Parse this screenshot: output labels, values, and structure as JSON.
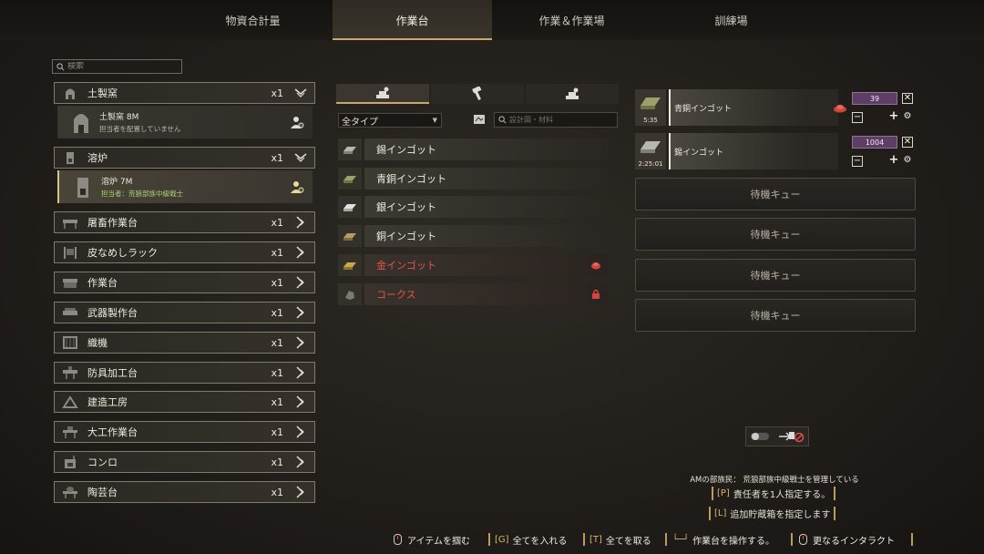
{
  "tabs": [
    {
      "label": "物資合計量"
    },
    {
      "label": "作業台"
    },
    {
      "label": "作業＆作業場"
    },
    {
      "label": "訓練場"
    }
  ],
  "active_tab": 1,
  "search": {
    "placeholder": "検索"
  },
  "stations": [
    {
      "name": "土製窯",
      "count": "x1",
      "icon": "kiln-icon",
      "expanded": true
    },
    {
      "name": "溶炉",
      "count": "x1",
      "icon": "furnace-icon",
      "expanded": true
    },
    {
      "name": "屠畜作業台",
      "count": "x1",
      "icon": "butcher-table-icon"
    },
    {
      "name": "皮なめしラック",
      "count": "x1",
      "icon": "tanning-rack-icon"
    },
    {
      "name": "作業台",
      "count": "x1",
      "icon": "workbench-icon"
    },
    {
      "name": "武器製作台",
      "count": "x1",
      "icon": "weapon-bench-icon"
    },
    {
      "name": "織機",
      "count": "x1",
      "icon": "loom-icon"
    },
    {
      "name": "防具加工台",
      "count": "x1",
      "icon": "armor-bench-icon"
    },
    {
      "name": "建造工房",
      "count": "x1",
      "icon": "construction-workshop-icon"
    },
    {
      "name": "大工作業台",
      "count": "x1",
      "icon": "carpentry-bench-icon"
    },
    {
      "name": "コンロ",
      "count": "x1",
      "icon": "stove-icon"
    },
    {
      "name": "陶芸台",
      "count": "x1",
      "icon": "pottery-bench-icon"
    }
  ],
  "sub_kiln": {
    "name": "土製窯 8M",
    "assign": "担当者を配置していません"
  },
  "sub_furnace": {
    "name": "溶炉 7M",
    "assign": "担当者：荒狼部族中級戦士"
  },
  "type_select": {
    "value": "全タイプ"
  },
  "search2": {
    "placeholder": "設計図・材料"
  },
  "recipes": [
    {
      "name": "錫インゴット",
      "locked": false
    },
    {
      "name": "青銅インゴット",
      "locked": false
    },
    {
      "name": "銀インゴット",
      "locked": false
    },
    {
      "name": "銅インゴット",
      "locked": false
    },
    {
      "name": "金インゴット",
      "locked": true,
      "tag": "material-missing-icon"
    },
    {
      "name": "コークス",
      "locked": true,
      "tag": "lock-icon"
    }
  ],
  "queue": [
    {
      "name": "青銅インゴット",
      "time": "5:35",
      "count": "39"
    },
    {
      "name": "錫インゴット",
      "time": "2:25:01",
      "count": "1004"
    }
  ],
  "waiting": [
    "待機キュー",
    "待機キュー",
    "待機キュー",
    "待機キュー"
  ],
  "manager": "AMの部族民： 荒狼部族中級戦士を管理している",
  "assign_hint": {
    "key": "[P]",
    "text": "責任者を1人指定する。"
  },
  "storage_hint": {
    "key": "[L]",
    "text": "追加貯蔵箱を指定します"
  },
  "bottom": [
    {
      "key": "",
      "text": "アイテムを掴む",
      "mouse": true
    },
    {
      "key": "[G]",
      "text": "全てを入れる"
    },
    {
      "key": "[T]",
      "text": "全てを取る"
    },
    {
      "key": "└─┘",
      "text": "作業台を操作する。"
    },
    {
      "key": "",
      "text": "更なるインタラクト",
      "mouse": true
    }
  ],
  "colors": {
    "accent": "#c9a86b",
    "locked": "#e2564b",
    "assigned": "#a8d177",
    "count_bg": "#5d3f66"
  }
}
